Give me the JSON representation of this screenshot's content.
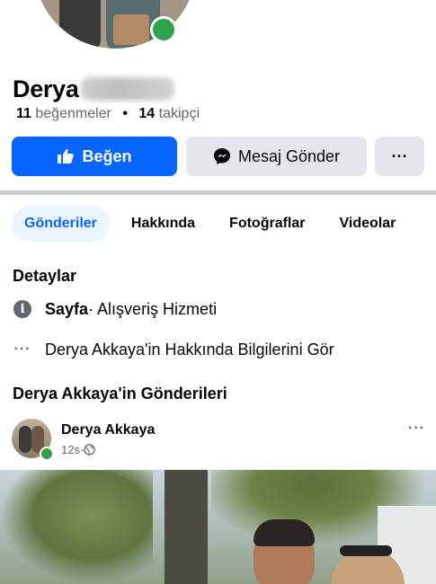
{
  "profile": {
    "name": "Derya",
    "likes_count": "11",
    "likes_label": "beğenmeler",
    "separator": "•",
    "followers_count": "14",
    "followers_label": "takipçi"
  },
  "actions": {
    "like_label": "Beğen",
    "message_label": "Mesaj Gönder",
    "more_label": "···"
  },
  "tabs": [
    {
      "label": "Gönderiler",
      "active": true
    },
    {
      "label": "Hakkında",
      "active": false
    },
    {
      "label": "Fotoğraflar",
      "active": false
    },
    {
      "label": "Videolar",
      "active": false
    }
  ],
  "details": {
    "title": "Detaylar",
    "category_strong": "Sayfa",
    "category_rest": " · Alışveriş Hizmeti",
    "see_about": "Derya Akkaya'in Hakkında Bilgilerini Gör",
    "more_icon": "···"
  },
  "posts_section": {
    "title": "Derya Akkaya'in Gönderileri"
  },
  "post": {
    "author": "Derya Akkaya",
    "time": "12s",
    "meta_sep": " · ",
    "more_icon": "···"
  },
  "icons": {
    "thumbs_up": "thumbs-up-icon",
    "messenger": "messenger-icon",
    "info": "info-icon",
    "globe": "globe-icon"
  },
  "colors": {
    "primary": "#0866ff",
    "online": "#31a24c",
    "secondary_button": "#e4e6eb",
    "active_tab_bg": "#ebf5ff"
  }
}
